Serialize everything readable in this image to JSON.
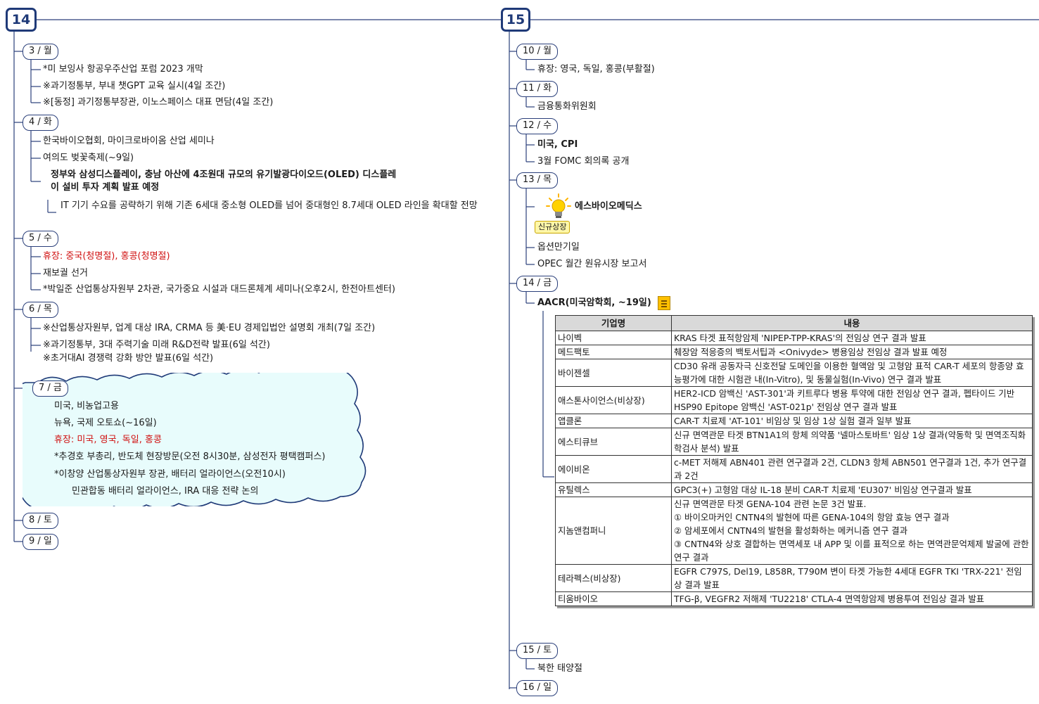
{
  "weeks": [
    {
      "label": "14",
      "days": [
        {
          "label": "3 / 월",
          "items": [
            {
              "text": "*미 보잉사 항공우주산업 포럼 2023 개막"
            },
            {
              "text": "※과기정통부, 부내 챗GPT 교육 실시(4일 조간)"
            },
            {
              "text": "※[동정] 과기정통부장관, 이노스페이스 대표 면담(4일 조간)"
            }
          ]
        },
        {
          "label": "4 / 화",
          "items": [
            {
              "text": "한국바이오협회, 마이크로바이옴 산업 세미나"
            },
            {
              "text": "여의도 벚꽃축제(~9일)"
            },
            {
              "text": "정부와 삼성디스플레이, 충남 아산에 4조원대 규모의 유기발광다이오드(OLED) 디스플레이 설비 투자 계획 발표 예정",
              "style": "bold"
            },
            {
              "text": "IT 기기 수요를 공략하기 위해 기존 6세대 중소형 OLED를 넘어 중대형인 8.7세대 OLED 라인을 확대할 전망",
              "sub": true
            }
          ]
        },
        {
          "label": "5 / 수",
          "items": [
            {
              "text": "휴장: 중국(청명절), 홍콩(청명절)",
              "style": "red"
            },
            {
              "text": "재보궐 선거"
            },
            {
              "text": "*박일준 산업통상자원부 2차관, 국가중요 시설과 대드론체계 세미나(오후2시, 한전아트센터)"
            }
          ]
        },
        {
          "label": "6 / 목",
          "items": [
            {
              "text": "※산업통상자원부, 업계 대상 IRA, CRMA 등 美·EU 경제입법안 설명회 개최(7일 조간)"
            },
            {
              "text": "※과기정통부, 3대 주력기술 미래 R&D전략 발표(6일 석간)"
            },
            {
              "text": "※초거대AI 경쟁력 강화 방안 발표(6일 석간)"
            }
          ]
        },
        {
          "label": "7 / 금",
          "items": [
            {
              "text": "미국, 비농업고용"
            },
            {
              "text": "뉴욕, 국제 오토쇼(~16일)"
            },
            {
              "text": "휴장: 미국, 영국, 독일, 홍콩",
              "style": "red"
            },
            {
              "text": "*추경호 부총리, 반도체 현장방문(오전 8시30분, 삼성전자 평택캠퍼스)"
            },
            {
              "text": "*이창양 산업통상자원부 장관, 배터리 얼라이언스(오전10시)"
            },
            {
              "text": "민관합동 배터리 얼라이언스, IRA 대응 전략 논의",
              "sub": true
            }
          ]
        },
        {
          "label": "8 / 토",
          "items": []
        },
        {
          "label": "9 / 일",
          "items": []
        }
      ]
    },
    {
      "label": "15",
      "days": [
        {
          "label": "10 / 월",
          "items": [
            {
              "text": "휴장: 영국, 독일, 홍콩(부활절)"
            }
          ]
        },
        {
          "label": "11 / 화",
          "items": [
            {
              "text": "금융통화위원회"
            }
          ]
        },
        {
          "label": "12 / 수",
          "items": [
            {
              "text": "미국, CPI",
              "style": "bold"
            },
            {
              "text": "3월 FOMC 회의록 공개"
            }
          ]
        },
        {
          "label": "13 / 목",
          "items": [
            {
              "text": "에스바이오메딕스",
              "style": "bold",
              "icon": "lightbulb-icon",
              "badge": "신규상장"
            },
            {
              "text": "옵션만기일"
            },
            {
              "text": "OPEC 월간 원유시장 보고서"
            }
          ]
        },
        {
          "label": "14 / 금",
          "items": [
            {
              "text": "AACR(미국암학회, ~19일)",
              "style": "bold",
              "icon": "note-icon"
            }
          ]
        },
        {
          "label": "15 / 토",
          "items": [
            {
              "text": "북한 태양절"
            }
          ]
        },
        {
          "label": "16 / 일",
          "items": []
        }
      ]
    }
  ],
  "aacr_table": {
    "headers": [
      "기업명",
      "내용"
    ],
    "rows": [
      [
        "나이벡",
        "KRAS 타겟 표적항암제 'NIPEP-TPP-KRAS'의 전임상 연구 결과 발표"
      ],
      [
        "메드팩토",
        "췌장암 적응증의 백토서팁과 <Onivyde> 병용임상 전임상 결과 발표 예정"
      ],
      [
        "바이젠셀",
        "CD30 유래 공동자극 신호전달 도메인을 이용한 혈액암 및 고형암 표적 CAR-T 세포의 항종양 효능평가에 대한 시험관 내(In-Vitro), 및 동물실험(In-Vivo) 연구 결과 발표"
      ],
      [
        "애스톤사이언스(비상장)",
        "HER2-ICD 암백신 'AST-301'과 키트루다 병용 투약에 대한 전임상 연구 결과, 펩타이드 기반 HSP90 Epitope 암백신 'AST-021p' 전임상 연구 결과 발표"
      ],
      [
        "앱클론",
        "CAR-T 치료제 'AT-101' 비임상 및 임상 1상 실험 결과 일부 발표"
      ],
      [
        "에스티큐브",
        "신규 면역관문 타겟 BTN1A1의 항체 의약품 '넬마스토바트' 임상 1상 결과(약동학 및 면역조직화학검사 분석) 발표"
      ],
      [
        "에이비온",
        "c-MET 저해제 ABN401 관련 연구결과 2건, CLDN3 항체 ABN501 연구결과 1건, 추가 연구결과 2건"
      ],
      [
        "유틸렉스",
        "GPC3(+) 고형암 대상 IL-18 분비 CAR-T 치료제 'EU307' 비임상 연구결과 발표"
      ],
      [
        "지놈앤컴퍼니",
        "신규 면역관문 타겟 GENA-104 관련 논문 3건 발표.\n① 바이오마커인 CNTN4의 발현에 따른 GENA-104의 항암 효능 연구 결과\n② 암세포에서 CNTN4의 발현을 활성화하는 메커니즘 연구 결과\n③ CNTN4와 상호 결합하는 면역세포 내 APP 및 이를 표적으로 하는 면역관문억제제 발굴에 관한 연구 결과"
      ],
      [
        "테라펙스(비상장)",
        "EGFR C797S, Del19, L858R, T790M 변이 타겟 가능한 4세대 EGFR TKI 'TRX-221' 전임상 결과 발표"
      ],
      [
        "티움바이오",
        "TFG-β, VEGFR2 저해제 'TU2218' CTLA-4 면역항암제 병용투여 전임상 결과 발표"
      ]
    ]
  }
}
